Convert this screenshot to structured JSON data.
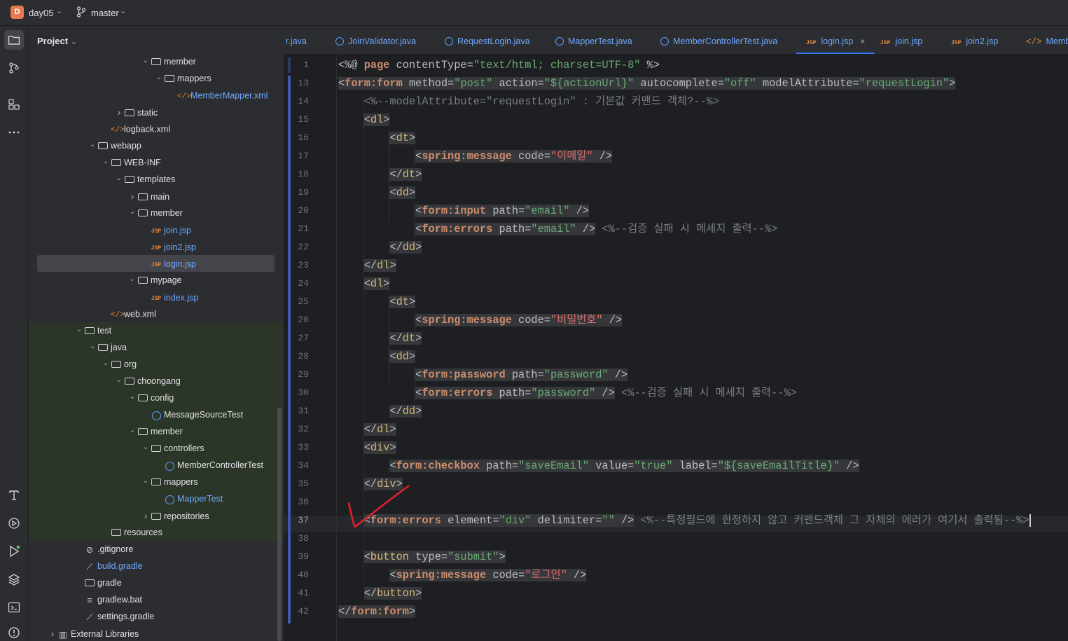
{
  "titlebar": {
    "project_badge": "D",
    "project_name": "day05",
    "branch": "master"
  },
  "toolstrip": {
    "icons": [
      "folder-icon",
      "git-icon",
      "structure-icon",
      "more-icon",
      "build-icon",
      "services-icon",
      "run-icon",
      "layers-icon",
      "terminal-icon",
      "problems-icon"
    ]
  },
  "project_panel": {
    "title": "Project",
    "tree": [
      {
        "label": "member",
        "kind": "folder",
        "expanded": true
      },
      {
        "label": "mappers",
        "kind": "folder",
        "expanded": true
      },
      {
        "label": "MemberMapper.xml",
        "kind": "xml"
      },
      {
        "label": "static",
        "kind": "folder",
        "expanded": false
      },
      {
        "label": "logback.xml",
        "kind": "xml"
      },
      {
        "label": "webapp",
        "kind": "folder",
        "expanded": true
      },
      {
        "label": "WEB-INF",
        "kind": "folder",
        "expanded": true
      },
      {
        "label": "templates",
        "kind": "folder",
        "expanded": true
      },
      {
        "label": "main",
        "kind": "folder",
        "expanded": false
      },
      {
        "label": "member",
        "kind": "folder",
        "expanded": true
      },
      {
        "label": "join.jsp",
        "kind": "jsp"
      },
      {
        "label": "join2.jsp",
        "kind": "jsp"
      },
      {
        "label": "login.jsp",
        "kind": "jsp",
        "selected": true
      },
      {
        "label": "mypage",
        "kind": "folder",
        "expanded": true
      },
      {
        "label": "index.jsp",
        "kind": "jsp"
      },
      {
        "label": "web.xml",
        "kind": "xml"
      },
      {
        "label": "test",
        "kind": "folder",
        "expanded": true
      },
      {
        "label": "java",
        "kind": "folder",
        "expanded": true
      },
      {
        "label": "org",
        "kind": "folder",
        "expanded": true
      },
      {
        "label": "choongang",
        "kind": "folder",
        "expanded": true
      },
      {
        "label": "config",
        "kind": "folder",
        "expanded": true
      },
      {
        "label": "MessageSourceTest",
        "kind": "class"
      },
      {
        "label": "member",
        "kind": "folder",
        "expanded": true
      },
      {
        "label": "controllers",
        "kind": "folder",
        "expanded": true
      },
      {
        "label": "MemberControllerTest",
        "kind": "class"
      },
      {
        "label": "mappers",
        "kind": "folder",
        "expanded": true
      },
      {
        "label": "MapperTest",
        "kind": "class"
      },
      {
        "label": "repositories",
        "kind": "folder",
        "expanded": false
      },
      {
        "label": "resources",
        "kind": "folder"
      },
      {
        "label": ".gitignore",
        "kind": "file"
      },
      {
        "label": "build.gradle",
        "kind": "gradle"
      },
      {
        "label": "gradle",
        "kind": "folder"
      },
      {
        "label": "gradlew.bat",
        "kind": "file"
      },
      {
        "label": "settings.gradle",
        "kind": "gradle"
      },
      {
        "label": "External Libraries",
        "kind": "lib",
        "expanded": false
      }
    ]
  },
  "tabs": [
    {
      "label": "r.java",
      "kind": "plain"
    },
    {
      "label": "JoinValidator.java",
      "kind": "class"
    },
    {
      "label": "RequestLogin.java",
      "kind": "class"
    },
    {
      "label": "MapperTest.java",
      "kind": "class"
    },
    {
      "label": "MemberControllerTest.java",
      "kind": "class"
    },
    {
      "label": "login.jsp",
      "kind": "jsp",
      "active": true
    },
    {
      "label": "join.jsp",
      "kind": "jsp"
    },
    {
      "label": "join2.jsp",
      "kind": "jsp"
    },
    {
      "label": "Membe",
      "kind": "xml"
    }
  ],
  "editor": {
    "current_line": "37",
    "line_numbers": [
      "1",
      "13",
      "14",
      "15",
      "16",
      "17",
      "18",
      "19",
      "20",
      "21",
      "22",
      "23",
      "24",
      "25",
      "26",
      "27",
      "28",
      "29",
      "30",
      "31",
      "32",
      "33",
      "34",
      "35",
      "36",
      "37",
      "38",
      "39",
      "40",
      "41",
      "42"
    ],
    "lines": [
      "<%@ page contentType=\"text/html; charset=UTF-8\" %>",
      "<form:form method=\"post\" action=\"${actionUrl}\" autocomplete=\"off\" modelAttribute=\"requestLogin\">",
      "    <%--modelAttribute=\"requestLogin\" : 기본값 커맨드 객체?--%>",
      "    <dl>",
      "        <dt>",
      "            <spring:message code=\"이메일\" />",
      "        </dt>",
      "        <dd>",
      "            <form:input path=\"email\" />",
      "            <form:errors path=\"email\" /> <%--검증 실패 시 메세지 출력--%>",
      "        </dd>",
      "    </dl>",
      "    <dl>",
      "        <dt>",
      "            <spring:message code=\"비밀번호\" />",
      "        </dt>",
      "        <dd>",
      "            <form:password path=\"password\" />",
      "            <form:errors path=\"password\" /> <%--검증 실패 시 메세지 출력--%>",
      "        </dd>",
      "    </dl>",
      "    <div>",
      "        <form:checkbox path=\"saveEmail\" value=\"true\" label=\"${saveEmailTitle}\" />",
      "    </div>",
      "",
      "    <form:errors element=\"div\" delimiter=\"\" /> <%--특정필드에 한정하지 않고 커맨드객체 그 자체의 에러가 여기서 출력됨--%>",
      "",
      "    <button type=\"submit\">",
      "        <spring:message code=\"로그인\" />",
      "    </button>",
      "</form:form>"
    ]
  },
  "colors": {
    "accent": "#3574f0",
    "annotation_red": "#e0212b"
  }
}
